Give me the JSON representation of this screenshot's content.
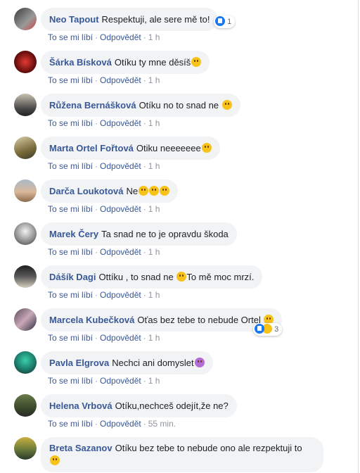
{
  "actions": {
    "like": "To se mi líbí",
    "reply": "Odpovědět",
    "sep": "·"
  },
  "comments": [
    {
      "author": "Neo Tapout",
      "text": "Respektuji, ale sere mě to!",
      "time": "1 h",
      "reactions": "1"
    },
    {
      "author": "Šárka Bísková",
      "text": "Otíku ty mne děsíš",
      "time": "1 h"
    },
    {
      "author": "Růžena Bernášková",
      "text": "Otíku no to snad ne",
      "time": "1 h"
    },
    {
      "author": "Marta Ortel Fořtová",
      "text": "Otiku neeeeeee",
      "time": "1 h"
    },
    {
      "author": "Darča Loukotová",
      "text": "Ne",
      "time": "1 h"
    },
    {
      "author": "Marek Čery",
      "text": "Ta snad ne to je opravdu škoda",
      "time": "1 h"
    },
    {
      "author": "Dášík Dagi",
      "text": "Ottíku , to snad ne",
      "text2": "To mě moc mrzí.",
      "time": "1 h"
    },
    {
      "author": "Marcela Kubečková",
      "text": "Oťas bez tebe to nebude Ortel",
      "time": "1 h",
      "reactions": "3"
    },
    {
      "author": "Pavla Elgrova",
      "text": "Nechci ani domyslet",
      "time": "1 h"
    },
    {
      "author": "Helena Vrbová",
      "text": "Otíku,nechceš odejít,že ne?",
      "time": "55 min."
    },
    {
      "author": "Breta Sazanov",
      "text": "Otíku bez tebe to nebude ono ale rezpektuji to",
      "time": ""
    }
  ],
  "colors": {
    "link": "#385898",
    "bubble": "#f2f3f5",
    "muted": "#90949c"
  }
}
